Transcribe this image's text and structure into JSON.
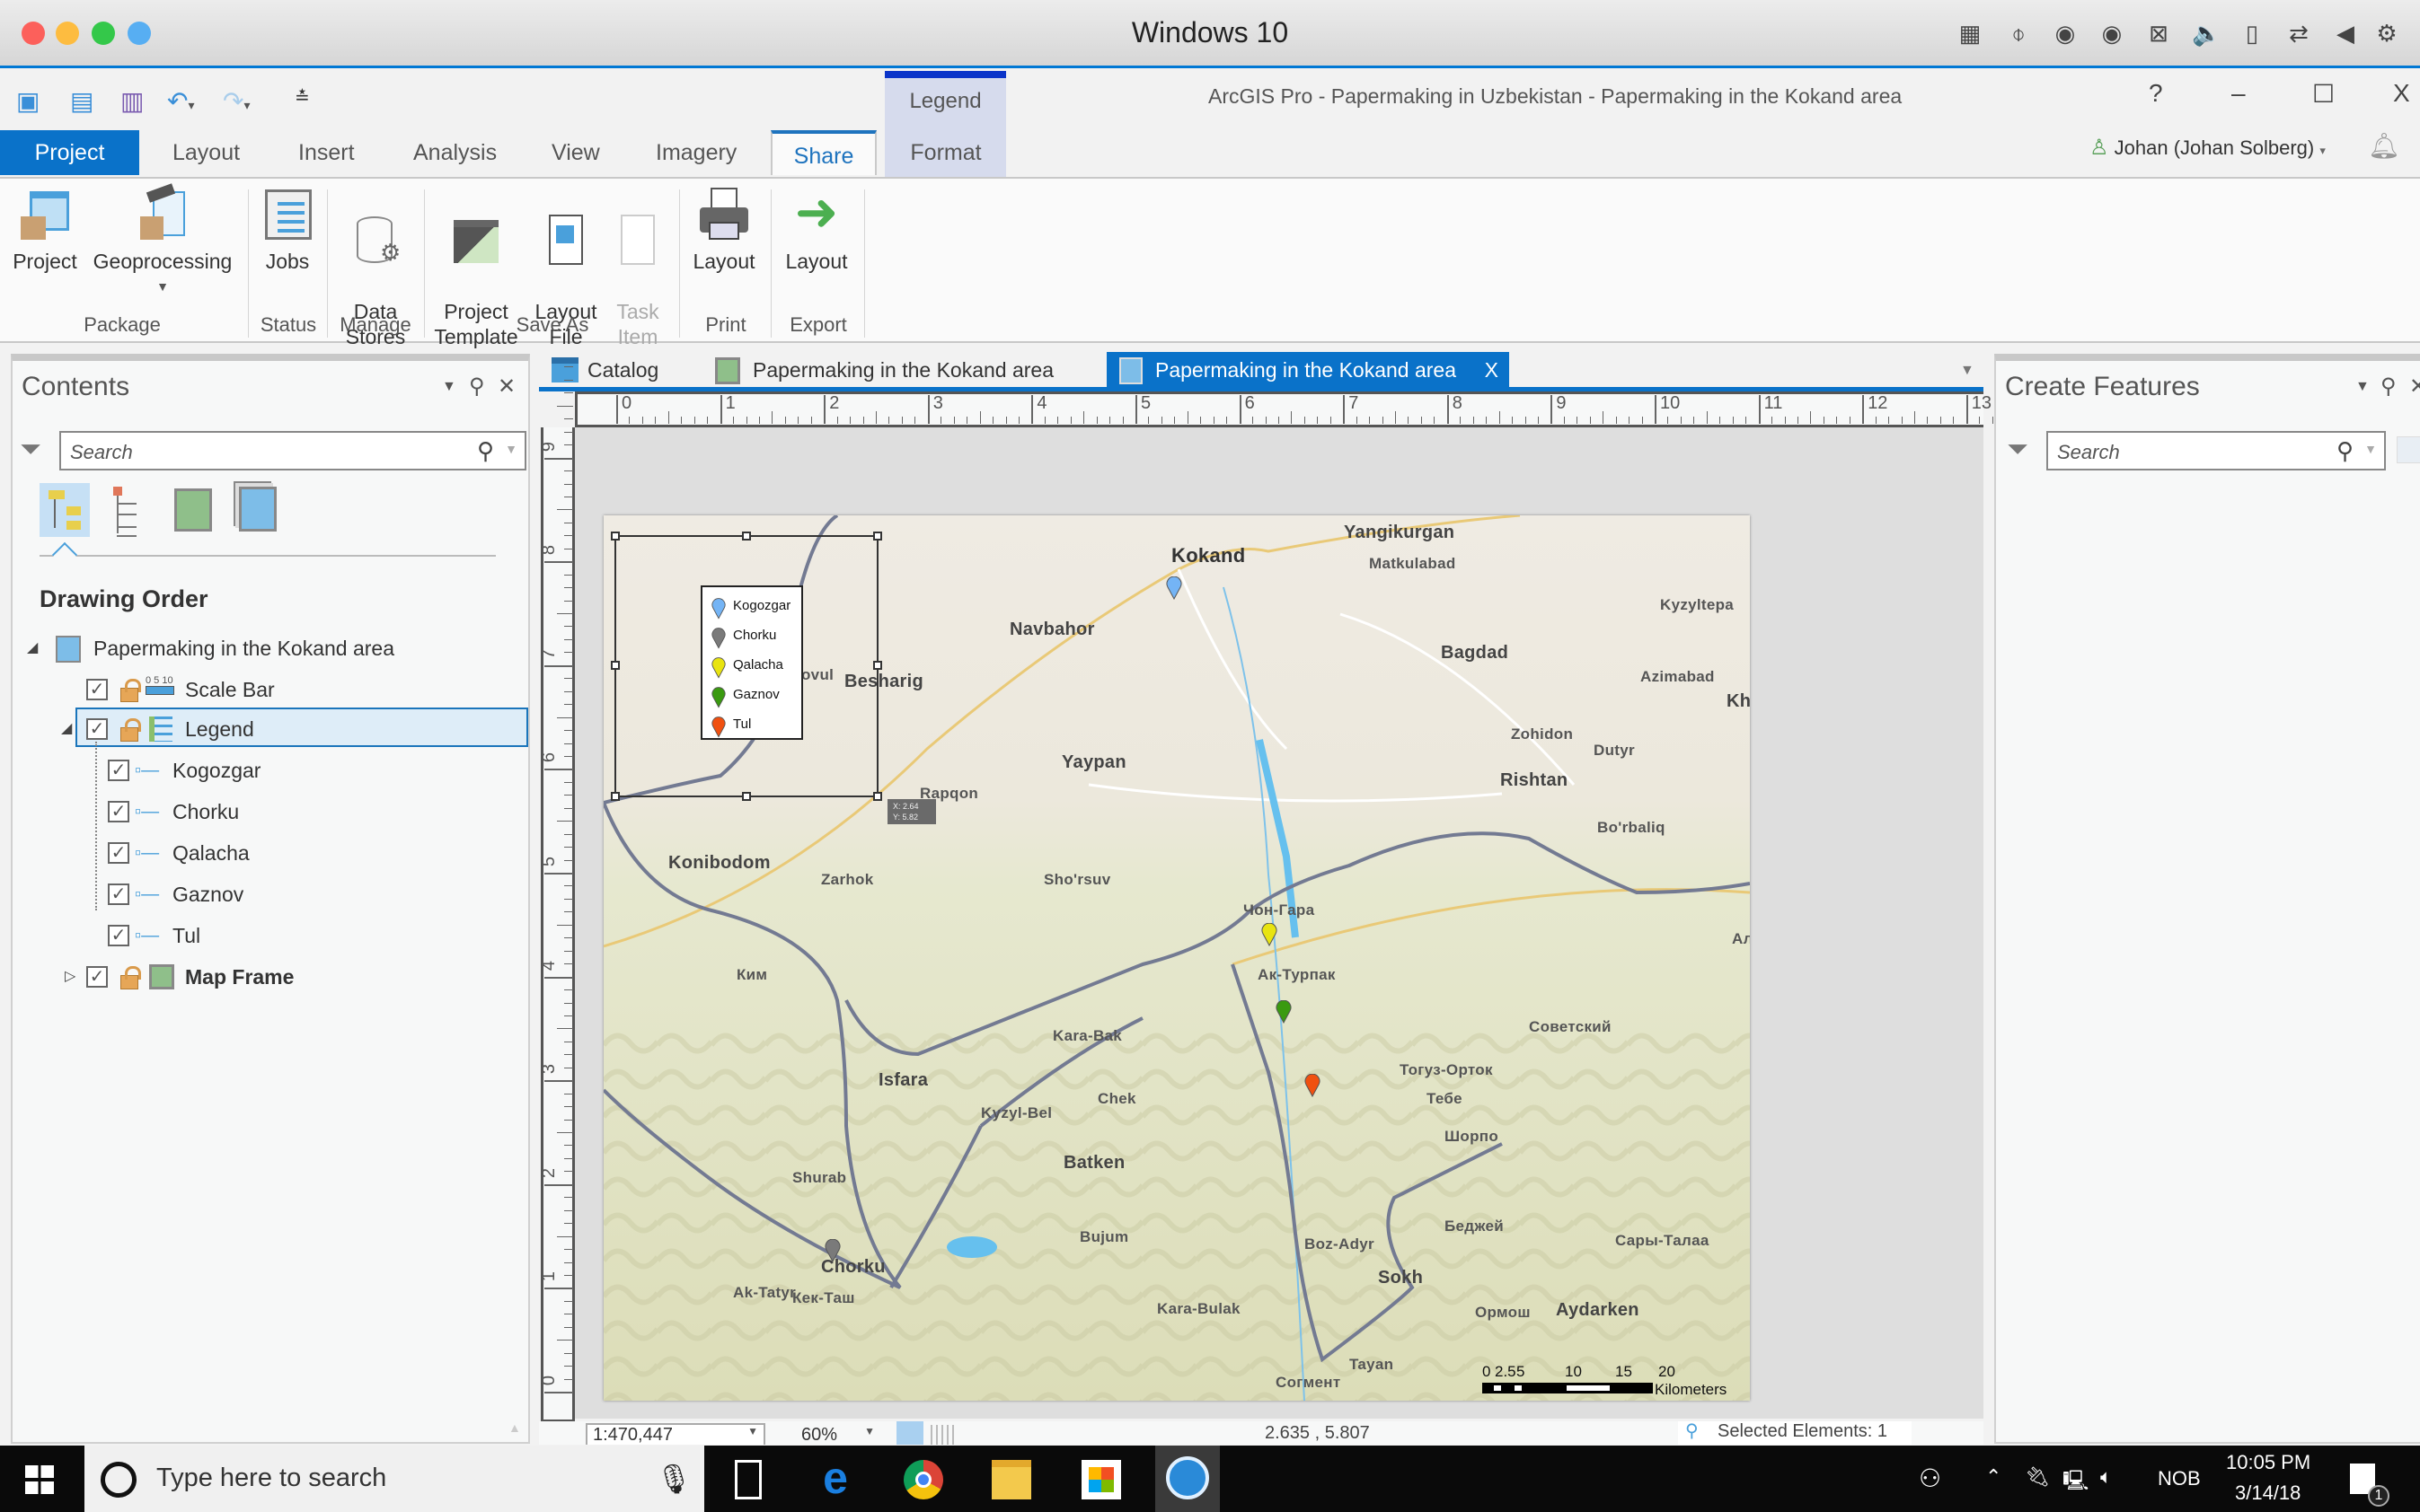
{
  "mac": {
    "title": "Windows 10",
    "traffic_colors": [
      "#fc605b",
      "#fdbc40",
      "#34c84a",
      "#57aef2"
    ]
  },
  "app": {
    "title": "ArcGIS Pro - Papermaking in Uzbekistan - Papermaking in the Kokand area",
    "help": "?",
    "minimize": "–",
    "maximize": "☐",
    "close": "X",
    "user": "Johan (Johan Solberg)",
    "contextual_group": "Legend"
  },
  "tabs": [
    {
      "label": "Project",
      "active": false
    },
    {
      "label": "Layout"
    },
    {
      "label": "Insert"
    },
    {
      "label": "Analysis"
    },
    {
      "label": "View"
    },
    {
      "label": "Imagery"
    },
    {
      "label": "Share",
      "active": true
    },
    {
      "label": "Format",
      "contextual": true
    }
  ],
  "ribbon": {
    "groups": [
      {
        "name": "Package",
        "buttons": [
          {
            "label": "Project"
          },
          {
            "label": "Geoprocessing",
            "dropdown": true
          }
        ]
      },
      {
        "name": "Status",
        "buttons": [
          {
            "label": "Jobs"
          }
        ]
      },
      {
        "name": "Manage",
        "buttons": [
          {
            "label": "Data\nStores"
          }
        ]
      },
      {
        "name": "Save As",
        "buttons": [
          {
            "label": "Project\nTemplate"
          },
          {
            "label": "Layout\nFile"
          },
          {
            "label": "Task\nItem",
            "disabled": true
          }
        ]
      },
      {
        "name": "Print",
        "buttons": [
          {
            "label": "Layout"
          }
        ]
      },
      {
        "name": "Export",
        "buttons": [
          {
            "label": "Layout"
          }
        ]
      }
    ]
  },
  "contents": {
    "title": "Contents",
    "search_placeholder": "Search",
    "section": "Drawing Order",
    "root": "Papermaking in the Kokand area",
    "items": [
      {
        "label": "Scale Bar",
        "checked": true
      },
      {
        "label": "Legend",
        "checked": true,
        "selected": true,
        "expanded": true
      },
      {
        "label": "Kogozgar",
        "checked": true,
        "child": true
      },
      {
        "label": "Chorku",
        "checked": true,
        "child": true
      },
      {
        "label": "Qalacha",
        "checked": true,
        "child": true
      },
      {
        "label": "Gaznov",
        "checked": true,
        "child": true
      },
      {
        "label": "Tul",
        "checked": true,
        "child": true
      },
      {
        "label": "Map Frame",
        "checked": true,
        "bold": true
      }
    ]
  },
  "doc_tabs": [
    {
      "label": "Catalog"
    },
    {
      "label": "Papermaking in the Kokand area"
    },
    {
      "label": "Papermaking in the Kokand area",
      "active": true,
      "close": "X"
    }
  ],
  "ruler": {
    "h_labels": [
      "0",
      "1",
      "2",
      "3",
      "4",
      "5",
      "6",
      "7",
      "8",
      "9",
      "10",
      "11",
      "12",
      "13"
    ],
    "v_labels": [
      "9",
      "8",
      "7",
      "6",
      "5",
      "4",
      "3",
      "2",
      "1",
      "0"
    ]
  },
  "map": {
    "legend": [
      {
        "label": "Kogozgar",
        "color": "#74b4f5"
      },
      {
        "label": "Chorku",
        "color": "#7a7a7a"
      },
      {
        "label": "Qalacha",
        "color": "#e8e410"
      },
      {
        "label": "Gaznov",
        "color": "#3a9a10"
      },
      {
        "label": "Tul",
        "color": "#f05010"
      }
    ],
    "cursor_readout": {
      "x": "X: 2.64",
      "y": "Y: 5.82"
    },
    "places": [
      "Kokand",
      "Yangikurgan",
      "Matkulabad",
      "Kyzyltepa",
      "Navbahor",
      "Bagdad",
      "Azimabad",
      "Kh",
      "Besharig",
      "ovul",
      "Yaypan",
      "Zohidon",
      "Dutyr",
      "Rishtan",
      "Rapqon",
      "Bo'rbaliq",
      "Konibodom",
      "Zarhok",
      "Sho'rsuv",
      "Чон-Гара",
      "Ал",
      "Ак-Турпак",
      "Ким",
      "Советский",
      "Kara-Bak",
      "Тогуз-Орток",
      "Isfara",
      "Тебе",
      "Chek",
      "Kyzyl-Bel",
      "Шорпо",
      "Batken",
      "Shurab",
      "Беджей",
      "Bujum",
      "Boz-Adyr",
      "Сары-Талаа",
      "Chorku",
      "Sokh",
      "Ak-Tatyr",
      "Кек-Таш",
      "Kara-Bulak",
      "Ормош",
      "Aydarken",
      "Tayan",
      "Согмент"
    ],
    "scale_bar": {
      "labels": [
        "0",
        "2.5",
        "5",
        "10",
        "15",
        "20"
      ],
      "units": "Kilometers"
    }
  },
  "status": {
    "scale": "1:470,447",
    "zoom": "60%",
    "coords": "2.635 , 5.807",
    "selected": "Selected Elements: 1"
  },
  "create_features": {
    "title": "Create Features",
    "search_placeholder": "Search"
  },
  "taskbar": {
    "search_placeholder": "Type here to search",
    "lang": "NOB",
    "time": "10:05 PM",
    "date": "3/14/18",
    "notifications": "1"
  }
}
